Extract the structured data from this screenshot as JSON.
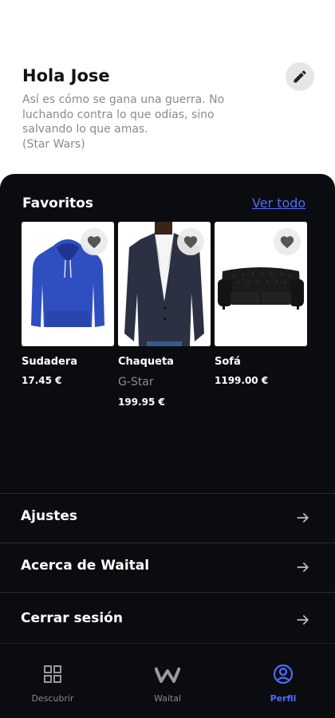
{
  "profile": {
    "greeting": "Hola Jose",
    "quote_lines": [
      "Así es cómo se gana una guerra. No",
      "luchando contra lo que odias, sino",
      "salvando lo que amas.",
      "(Star Wars)"
    ]
  },
  "favorites": {
    "title": "Favoritos",
    "see_all": "Ver todo",
    "items": [
      {
        "name": "Sudadera",
        "brand": "",
        "price": "17.45 €"
      },
      {
        "name": "Chaqueta",
        "brand": "G-Star",
        "price": "199.95 €"
      },
      {
        "name": "Sofá",
        "brand": "",
        "price": "1199.00 €"
      }
    ]
  },
  "menu": [
    {
      "label": "Ajustes",
      "icon": "arrow-right-icon"
    },
    {
      "label": "Acerca de Waital",
      "icon": "arrow-right-icon"
    },
    {
      "label": "Cerrar sesión",
      "icon": "arrow-right-icon"
    }
  ],
  "nav": [
    {
      "label": "Descubrir",
      "icon": "grid-icon",
      "active": false
    },
    {
      "label": "Waital",
      "icon": "waital-logo-icon",
      "active": false
    },
    {
      "label": "Perfil",
      "icon": "profile-icon",
      "active": true
    }
  ],
  "colors": {
    "accent": "#4f6bff",
    "dark_bg": "#0b0c10",
    "header_bg": "#ffffff"
  }
}
